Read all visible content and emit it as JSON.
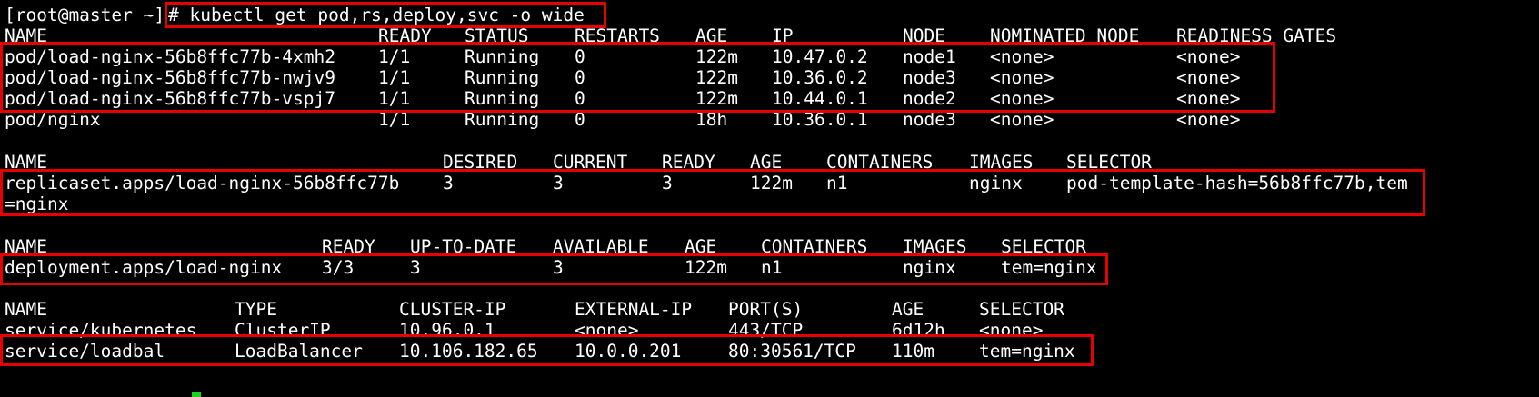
{
  "prompt": "[root@master ~]",
  "command": "# kubectl get pod,rs,deploy,svc -o wide",
  "pods": {
    "headers": [
      "NAME",
      "READY",
      "STATUS",
      "RESTARTS",
      "AGE",
      "IP",
      "NODE",
      "NOMINATED NODE",
      "READINESS GATES"
    ],
    "rows": [
      [
        "pod/load-nginx-56b8ffc77b-4xmh2",
        "1/1",
        "Running",
        "0",
        "122m",
        "10.47.0.2",
        "node1",
        "<none>",
        "<none>"
      ],
      [
        "pod/load-nginx-56b8ffc77b-nwjv9",
        "1/1",
        "Running",
        "0",
        "122m",
        "10.36.0.2",
        "node3",
        "<none>",
        "<none>"
      ],
      [
        "pod/load-nginx-56b8ffc77b-vspj7",
        "1/1",
        "Running",
        "0",
        "122m",
        "10.44.0.1",
        "node2",
        "<none>",
        "<none>"
      ],
      [
        "pod/nginx",
        "1/1",
        "Running",
        "0",
        "18h",
        "10.36.0.1",
        "node3",
        "<none>",
        "<none>"
      ]
    ]
  },
  "replicasets": {
    "headers": [
      "NAME",
      "DESIRED",
      "CURRENT",
      "READY",
      "AGE",
      "CONTAINERS",
      "IMAGES",
      "SELECTOR"
    ],
    "rows": [
      [
        "replicaset.apps/load-nginx-56b8ffc77b",
        "3",
        "3",
        "3",
        "122m",
        "n1",
        "nginx",
        "pod-template-hash=56b8ffc77b,tem"
      ]
    ],
    "wrap": "=nginx"
  },
  "deployments": {
    "headers": [
      "NAME",
      "READY",
      "UP-TO-DATE",
      "AVAILABLE",
      "AGE",
      "CONTAINERS",
      "IMAGES",
      "SELECTOR"
    ],
    "rows": [
      [
        "deployment.apps/load-nginx",
        "3/3",
        "3",
        "3",
        "122m",
        "n1",
        "nginx",
        "tem=nginx"
      ]
    ]
  },
  "services": {
    "headers": [
      "NAME",
      "TYPE",
      "CLUSTER-IP",
      "EXTERNAL-IP",
      "PORT(S)",
      "AGE",
      "SELECTOR"
    ],
    "rows": [
      [
        "service/kubernetes",
        "ClusterIP",
        "10.96.0.1",
        "<none>",
        "443/TCP",
        "6d12h",
        "<none>"
      ],
      [
        "service/loadbal",
        "LoadBalancer",
        "10.106.182.65",
        "10.0.0.201",
        "80:30561/TCP",
        "110m",
        "tem=nginx"
      ]
    ]
  },
  "colors": {
    "background": "#000000",
    "text": "#ffffff",
    "highlight": "#e60000",
    "cursor": "#1fd11f"
  }
}
